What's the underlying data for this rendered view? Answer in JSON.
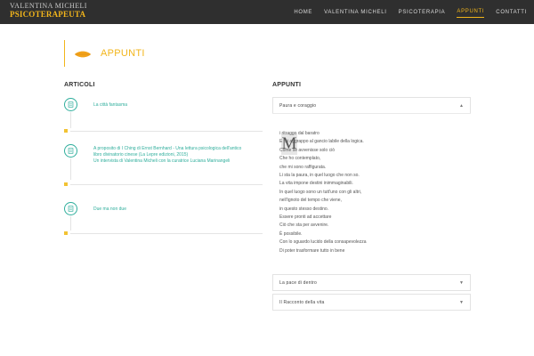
{
  "header": {
    "logo_line1": "VALENTINA MICHELI",
    "logo_line2": "PSICOTERAPEUTA",
    "nav": [
      {
        "label": "HOME",
        "active": false
      },
      {
        "label": "VALENTINA MICHELI",
        "active": false
      },
      {
        "label": "PSICOTERAPIA",
        "active": false
      },
      {
        "label": "APPUNTI",
        "active": true
      },
      {
        "label": "CONTATTI",
        "active": false
      }
    ]
  },
  "page": {
    "title": "APPUNTI",
    "leaf_icon": "leaf-icon"
  },
  "articles": {
    "heading": "ARTICOLI",
    "items": [
      {
        "lines": [
          "La città fantasma"
        ],
        "icon": "document-icon"
      },
      {
        "lines": [
          "A proposito di I Ching di Ernst Bernhard - Una lettura psicologica dell'antico",
          "libro divinatorio cinese (La Lepre edizioni, 2015)",
          "Un intervista di Valentina Micheli con la curatrice Luciana Marinangeli"
        ],
        "icon": "document-icon"
      },
      {
        "lines": [
          "Due ma non due"
        ],
        "icon": "document-icon"
      }
    ]
  },
  "appunti": {
    "heading": "APPUNTI",
    "accordion": [
      {
        "label": "Paura e coraggio",
        "open": true
      },
      {
        "label": "La pace di dentro",
        "open": false
      },
      {
        "label": "Il Racconto della vita",
        "open": false
      }
    ],
    "open_content": {
      "dropcap": "M",
      "lines": [
        "i ritraggo dal baratro",
        "E mi aggrappo al gancio labile della logica.",
        "Come se avvenisse solo ciò",
        "Che ho contemplato,",
        "che mi sono raffigurata.",
        "Li sta la paura, in quel luogo che non so.",
        "La vita impone destini inimmaginabili.",
        "In quel luogo sono un tutt'uno con gli altri,",
        "nell'ignoto del tempo che viene,",
        "in questo stesso destino.",
        "Essere pronti ad accettare",
        "Ciò che sta per avvenire.",
        "È possibile.",
        "Con lo sguardo lucido della consapevolezza",
        "Di poter trasformare tutto in bene"
      ]
    }
  },
  "colors": {
    "accent": "#f2b51b",
    "teal": "#2fae9c",
    "topbar": "#2f2f2f"
  }
}
